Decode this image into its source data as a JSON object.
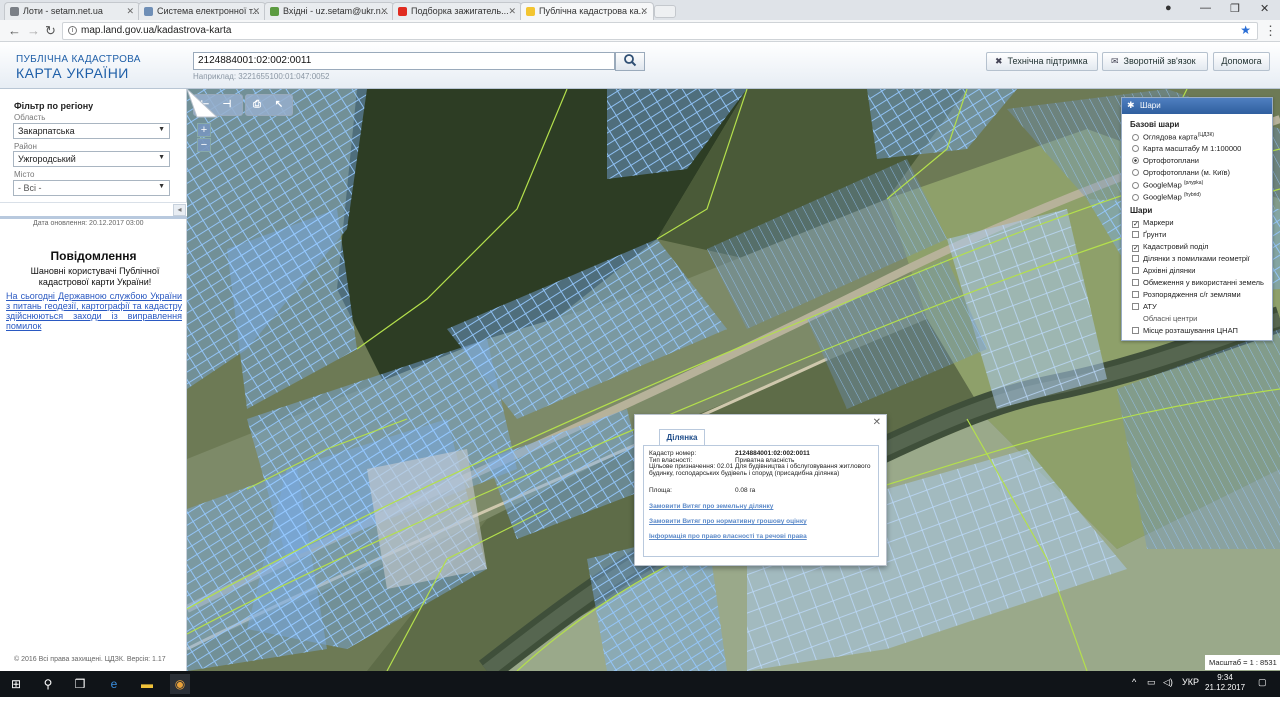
{
  "browser": {
    "tabs": [
      {
        "label": "Лоти - setam.net.ua",
        "color": "#7a7f86"
      },
      {
        "label": "Система електронної т...",
        "color": "#6f8fb7"
      },
      {
        "label": "Вхідні - uz.setam@ukr.n...",
        "color": "#5c9b41"
      },
      {
        "label": "Подборка зажигатель...",
        "color": "#e02b20"
      },
      {
        "label": "Публічна кадастрова ка...",
        "color": "#f3c531"
      }
    ],
    "url": "map.land.gov.ua/kadastrova-karta"
  },
  "header": {
    "logo_line1": "ПУБЛІЧНА КАДАСТРОВА",
    "logo_line2": "КАРТА УКРАЇНИ",
    "search_value": "2124884001:02:002:0011",
    "search_hint": "Наприклад: 3221655100:01:047:0052",
    "buttons": {
      "support": "Технічна підтримка",
      "feedback": "Зворотній зв'язок",
      "help": "Допомога"
    }
  },
  "filter": {
    "title": "Фільтр по регіону",
    "oblast_label": "Область",
    "oblast_value": "Закарпатська",
    "rayon_label": "Район",
    "rayon_value": "Ужгородський",
    "city_label": "Місто",
    "city_value": "- Всі -",
    "updated": "Дата оновлення: 20.12.2017 03:00"
  },
  "notice": {
    "title": "Повідомлення",
    "subtitle": "Шановні користувачі Публічної кадастрової карти України!",
    "link": "На сьогодні Державною службою України з питань геодезії, картографії та кадастру здійснюються заходи із виправлення помилок"
  },
  "footer": {
    "copyright": "© 2016 Всі права захищені. ЦДЗК. Версія: 1.17"
  },
  "map_tools": {
    "zoom_in": "+",
    "zoom_out": "−"
  },
  "layers": {
    "title": "Шари",
    "base_title": "Базові шари",
    "base": [
      {
        "label": "Оглядова карта",
        "sup": "(ЦДЗК)",
        "selected": false
      },
      {
        "label": "Карта масштабу М 1:100000",
        "sup": "",
        "selected": false
      },
      {
        "label": "Ортофотоплани",
        "sup": "",
        "selected": true
      },
      {
        "label": "Ортофотоплани (м. Київ)",
        "sup": "",
        "selected": false
      },
      {
        "label": "GoogleMap",
        "sup": "(рлурkа)",
        "selected": false
      },
      {
        "label": "GoogleMap",
        "sup": "(hybrid)",
        "selected": false
      }
    ],
    "overlay_title": "Шари",
    "overlays": [
      {
        "label": "Маркери",
        "checked": true
      },
      {
        "label": "Ґрунти",
        "checked": false
      },
      {
        "label": "Кадастровий поділ",
        "checked": true
      },
      {
        "label": "Ділянки з помилками геометрії",
        "checked": false
      },
      {
        "label": "Архівні ділянки",
        "checked": false
      },
      {
        "label": "Обмеження у використанні земель",
        "checked": false
      },
      {
        "label": "Розпорядження с/г землями",
        "checked": false
      },
      {
        "label": "АТУ",
        "checked": false
      },
      {
        "label": "Обласні центри",
        "checked": false,
        "nobox": true
      },
      {
        "label": "Місце розташування ЦНАП",
        "checked": false
      }
    ]
  },
  "popup": {
    "tab": "Ділянка",
    "cad_label": "Кадастр номер:",
    "cad_value": "2124884001:02:002:0011",
    "own_label": "Тип власності:",
    "own_value": "Приватна власність",
    "purpose_text": "Цільове призначення: 02.01 Для будівництва і обслуговування житлового будинку, господарських будівель і споруд (присадибна ділянка)",
    "area_label": "Площа:",
    "area_value": "0.08 га",
    "link1": "Замовити Витяг про земельну ділянку",
    "link2": "Замовити Витяг про нормативну грошову оцінку",
    "link3": "Інформація про право власності та речові права"
  },
  "scale": "Масштаб = 1 : 8531",
  "taskbar": {
    "lang": "УКР",
    "time": "9:34",
    "date": "21.12.2017"
  }
}
